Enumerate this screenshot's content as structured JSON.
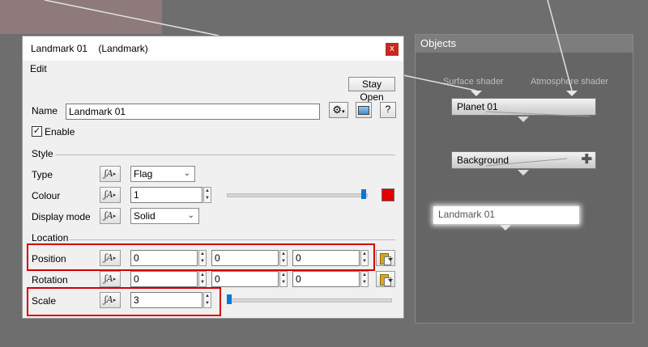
{
  "dialog": {
    "title": "Landmark 01    (Landmark)",
    "close_glyph": "x",
    "menu_edit": "Edit",
    "stay_open_label": "Stay Open",
    "help_glyph": "?",
    "name_label": "Name",
    "name_value": "Landmark 01",
    "enable_label": "Enable",
    "enable_checked": true,
    "style_section": "Style",
    "type_label": "Type",
    "type_value": "Flag",
    "colour_label": "Colour",
    "colour_value": "1",
    "colour_swatch": "#e00000",
    "display_mode_label": "Display mode",
    "display_mode_value": "Solid",
    "location_section": "Location",
    "position_label": "Position",
    "position_values": [
      "0",
      "0",
      "0"
    ],
    "rotation_label": "Rotation",
    "rotation_values": [
      "0",
      "0",
      "0"
    ],
    "scale_label": "Scale",
    "scale_value": "3"
  },
  "objects": {
    "header": "Objects",
    "surface_shader_label": "Surface shader",
    "atmosphere_shader_label": "Atmosphere shader",
    "planet_node": "Planet 01",
    "background_node": "Background",
    "landmark_node": "Landmark 01"
  },
  "colors": {
    "accent": "#0078d7",
    "highlight": "#d40000"
  }
}
